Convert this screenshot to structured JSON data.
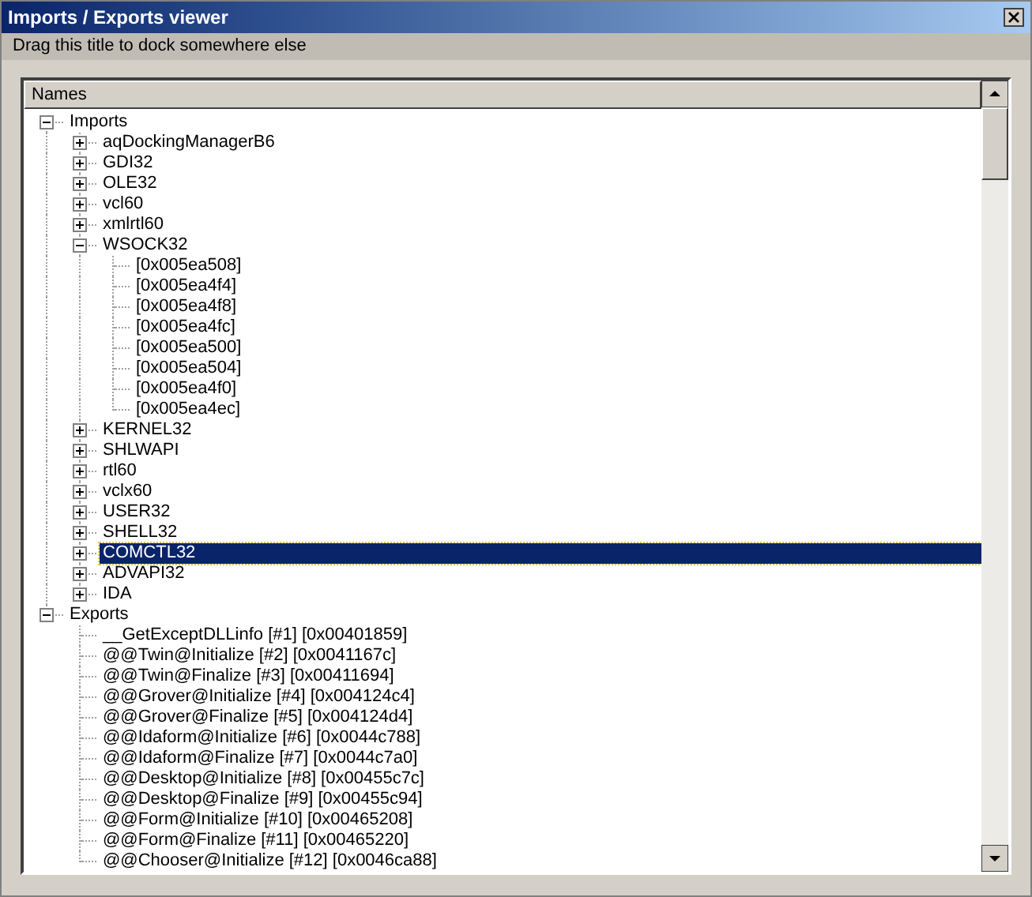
{
  "window": {
    "title": "Imports / Exports viewer"
  },
  "dock_hint": "Drag this title to dock somewhere else",
  "tree": {
    "column": "Names",
    "nodes": [
      {
        "label": "Imports",
        "expanded": true,
        "selected": false,
        "children": [
          {
            "label": "aqDockingManagerB6",
            "expanded": false,
            "selected": false
          },
          {
            "label": "GDI32",
            "expanded": false,
            "selected": false
          },
          {
            "label": "OLE32",
            "expanded": false,
            "selected": false
          },
          {
            "label": "vcl60",
            "expanded": false,
            "selected": false
          },
          {
            "label": "xmlrtl60",
            "expanded": false,
            "selected": false
          },
          {
            "label": "WSOCK32",
            "expanded": true,
            "selected": false,
            "children": [
              {
                "label": "[0x005ea508]",
                "selected": false
              },
              {
                "label": "[0x005ea4f4]",
                "selected": false
              },
              {
                "label": "[0x005ea4f8]",
                "selected": false
              },
              {
                "label": "[0x005ea4fc]",
                "selected": false
              },
              {
                "label": "[0x005ea500]",
                "selected": false
              },
              {
                "label": "[0x005ea504]",
                "selected": false
              },
              {
                "label": "[0x005ea4f0]",
                "selected": false
              },
              {
                "label": "[0x005ea4ec]",
                "selected": false
              }
            ]
          },
          {
            "label": "KERNEL32",
            "expanded": false,
            "selected": false
          },
          {
            "label": "SHLWAPI",
            "expanded": false,
            "selected": false
          },
          {
            "label": "rtl60",
            "expanded": false,
            "selected": false
          },
          {
            "label": "vclx60",
            "expanded": false,
            "selected": false
          },
          {
            "label": "USER32",
            "expanded": false,
            "selected": false
          },
          {
            "label": "SHELL32",
            "expanded": false,
            "selected": false
          },
          {
            "label": "COMCTL32",
            "expanded": false,
            "selected": true
          },
          {
            "label": "ADVAPI32",
            "expanded": false,
            "selected": false
          },
          {
            "label": "IDA",
            "expanded": false,
            "selected": false
          }
        ]
      },
      {
        "label": "Exports",
        "expanded": true,
        "selected": false,
        "children": [
          {
            "label": "__GetExceptDLLinfo [#1] [0x00401859]",
            "selected": false
          },
          {
            "label": "@@Twin@Initialize [#2] [0x0041167c]",
            "selected": false
          },
          {
            "label": "@@Twin@Finalize [#3] [0x00411694]",
            "selected": false
          },
          {
            "label": "@@Grover@Initialize [#4] [0x004124c4]",
            "selected": false
          },
          {
            "label": "@@Grover@Finalize [#5] [0x004124d4]",
            "selected": false
          },
          {
            "label": "@@Idaform@Initialize [#6] [0x0044c788]",
            "selected": false
          },
          {
            "label": "@@Idaform@Finalize [#7] [0x0044c7a0]",
            "selected": false
          },
          {
            "label": "@@Desktop@Initialize [#8] [0x00455c7c]",
            "selected": false
          },
          {
            "label": "@@Desktop@Finalize [#9] [0x00455c94]",
            "selected": false
          },
          {
            "label": "@@Form@Initialize [#10] [0x00465208]",
            "selected": false
          },
          {
            "label": "@@Form@Finalize [#11] [0x00465220]",
            "selected": false
          },
          {
            "label": "@@Chooser@Initialize [#12] [0x0046ca88]",
            "selected": false
          }
        ]
      }
    ]
  }
}
